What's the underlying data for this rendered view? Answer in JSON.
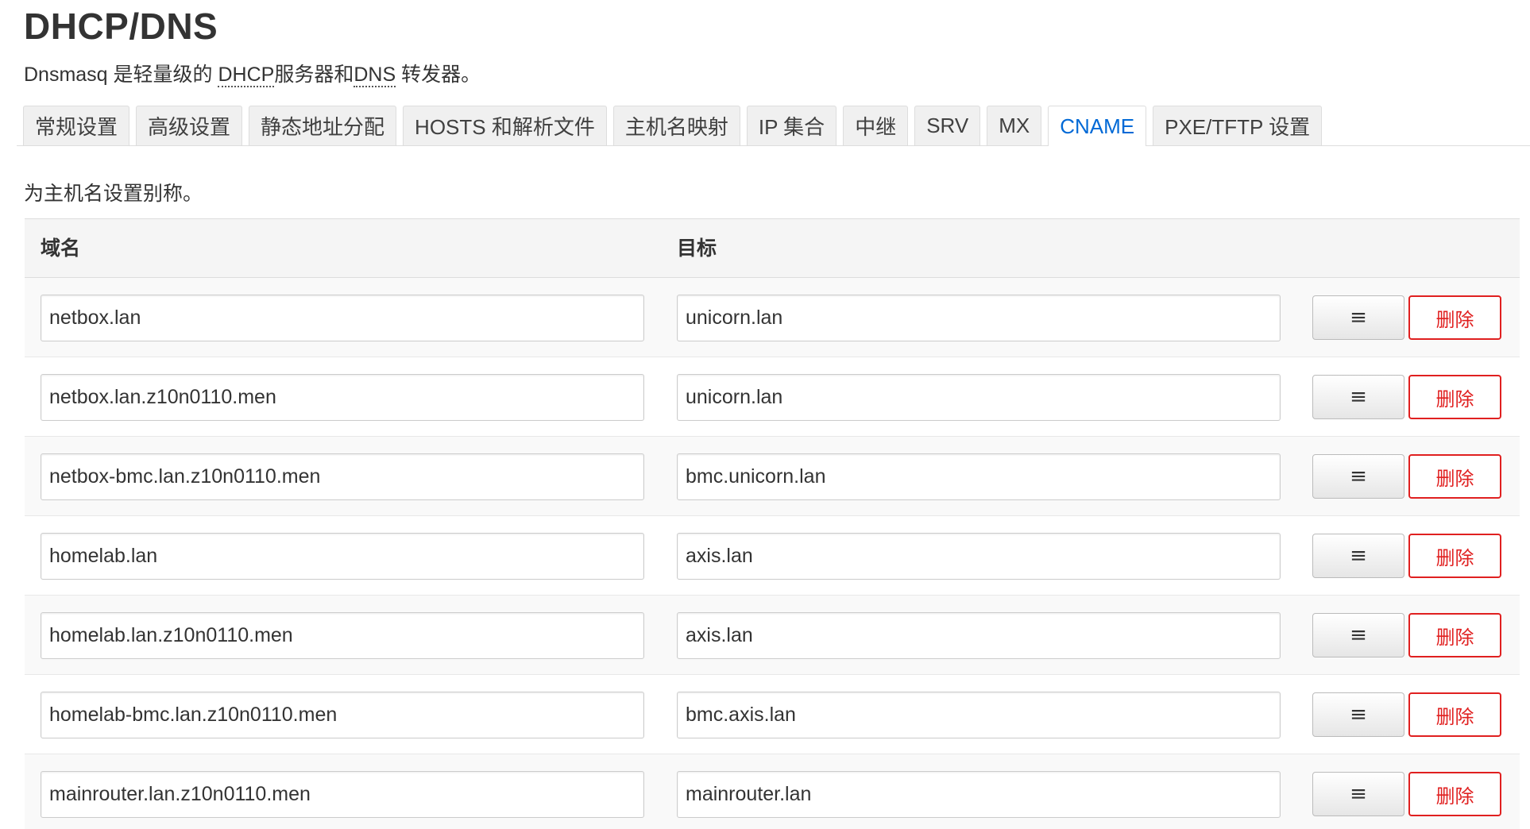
{
  "page": {
    "title": "DHCP/DNS",
    "desc_prefix": "Dnsmasq 是轻量级的 ",
    "desc_dhcp": "DHCP",
    "desc_middle": "服务器和",
    "desc_dns": "DNS",
    "desc_suffix": " 转发器。"
  },
  "tabs": [
    {
      "label": "常规设置",
      "active": false
    },
    {
      "label": "高级设置",
      "active": false
    },
    {
      "label": "静态地址分配",
      "active": false
    },
    {
      "label": "HOSTS 和解析文件",
      "active": false
    },
    {
      "label": "主机名映射",
      "active": false
    },
    {
      "label": "IP 集合",
      "active": false
    },
    {
      "label": "中继",
      "active": false
    },
    {
      "label": "SRV",
      "active": false
    },
    {
      "label": "MX",
      "active": false
    },
    {
      "label": "CNAME",
      "active": true
    },
    {
      "label": "PXE/TFTP 设置",
      "active": false
    }
  ],
  "section": {
    "description": "为主机名设置别称。"
  },
  "table": {
    "headers": {
      "domain": "域名",
      "target": "目标"
    },
    "sort_icon": "≡",
    "delete_label": "删除",
    "rows": [
      {
        "domain": "netbox.lan",
        "target": "unicorn.lan"
      },
      {
        "domain": "netbox.lan.z10n0110.men",
        "target": "unicorn.lan"
      },
      {
        "domain": "netbox-bmc.lan.z10n0110.men",
        "target": "bmc.unicorn.lan"
      },
      {
        "domain": "homelab.lan",
        "target": "axis.lan"
      },
      {
        "domain": "homelab.lan.z10n0110.men",
        "target": "axis.lan"
      },
      {
        "domain": "homelab-bmc.lan.z10n0110.men",
        "target": "bmc.axis.lan"
      },
      {
        "domain": "mainrouter.lan.z10n0110.men",
        "target": "mainrouter.lan"
      }
    ]
  },
  "colors": {
    "active_tab": "#0069d6",
    "delete": "#e02020"
  }
}
